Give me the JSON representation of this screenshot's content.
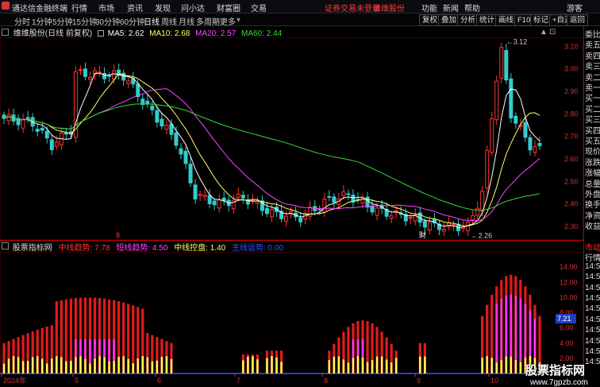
{
  "topbar": {
    "app_title": "通达信金融终端",
    "menus": [
      "行情",
      "市场",
      "资讯",
      "发现",
      "问小达",
      "财富圈",
      "交易"
    ],
    "login_notice": "证券交易未登录",
    "account": "维维股份",
    "right_items": [
      "功能",
      "新闻",
      "帮助",
      "游客"
    ]
  },
  "toolbar": {
    "periods": [
      "分时",
      "1分钟",
      "5分钟",
      "15分钟",
      "30分钟",
      "60分钟",
      "日线",
      "周线",
      "月线",
      "多周期",
      "更多"
    ],
    "active_period": "日线",
    "buttons": [
      "复权",
      "叠加",
      "分析",
      "统计",
      "画线",
      "F10",
      "标记",
      "+自选",
      "返回"
    ]
  },
  "main_chart": {
    "stock_label": "维维股份(日线 前复权)",
    "ma": [
      {
        "label": "MA5: 2.62",
        "color": "#ffffff"
      },
      {
        "label": "MA10: 2.68",
        "color": "#ffff66"
      },
      {
        "label": "MA20: 2.57",
        "color": "#ff44ff"
      },
      {
        "label": "MA60: 2.44",
        "color": "#33dd33"
      }
    ],
    "y_ticks": [
      "3.10",
      "3.00",
      "2.90",
      "2.80",
      "2.70",
      "2.60",
      "2.50",
      "2.40",
      "2.30"
    ],
    "high_label": "3.12",
    "low_label": "2.26",
    "event_marks": [
      "8",
      "财"
    ]
  },
  "sub_chart": {
    "title": "股票指标网",
    "indicators": [
      {
        "label": "中线趋势: 7.78",
        "color": "#ff3333"
      },
      {
        "label": "短线趋势: 4.50",
        "color": "#ff44ff"
      },
      {
        "label": "中线控盘: 1.40",
        "color": "#ffff66"
      },
      {
        "label": "主线运势: 0.00",
        "color": "#3355ff"
      }
    ],
    "y_ticks": [
      "14.00",
      "12.00",
      "10.00",
      "8.00",
      "6.00",
      "4.00",
      "2.00"
    ],
    "current_value": "7.21"
  },
  "x_axis": {
    "labels": [
      "2024年",
      "5",
      "6",
      "7",
      "8",
      "9",
      "10"
    ]
  },
  "right_panel": {
    "items": [
      "委比",
      "卖五",
      "卖四",
      "卖三",
      "卖二",
      "卖一",
      "买一",
      "买二",
      "买三",
      "买四",
      "买五",
      "现价",
      "涨跌",
      "涨幅",
      "总量",
      "外盘",
      "换手",
      "净资",
      "收益",
      "",
      "市动",
      "行情",
      "14:5",
      "14:5",
      "14:5",
      "14:5",
      "14:5",
      "14:5",
      "14:5",
      "14:5",
      "14:5",
      "14:5"
    ]
  },
  "watermark": {
    "text": "股票指标网",
    "url": "www.7gpzb.com"
  }
}
